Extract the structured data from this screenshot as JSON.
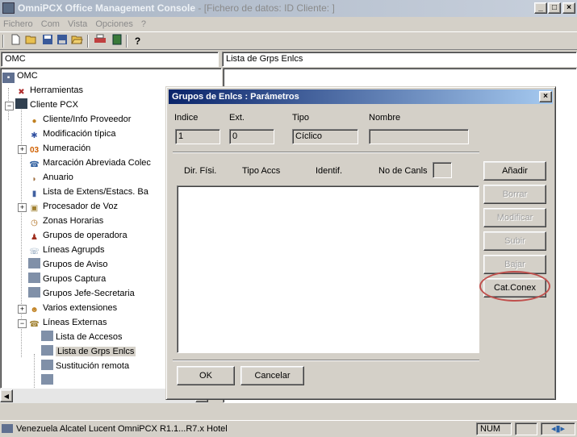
{
  "window": {
    "title_app": "OmniPCX Office Management Console",
    "title_detail": " - [Fichero de datos:    ID Cliente: ]",
    "btn_min": "_",
    "btn_max": "□",
    "btn_close": "×"
  },
  "menu": [
    "Fichero",
    "Com",
    "Vista",
    "Opciones",
    "?"
  ],
  "pathbar": {
    "left": "OMC",
    "right": "Lista de Grps Enlcs"
  },
  "tree": {
    "items": [
      {
        "label": "OMC"
      },
      {
        "label": "Herramientas"
      },
      {
        "label": "Cliente PCX"
      },
      {
        "label": "Cliente/Info Proveedor"
      },
      {
        "label": "Modificación típica"
      },
      {
        "label": "Numeración",
        "prefix": "03"
      },
      {
        "label": "Marcación Abreviada Colec"
      },
      {
        "label": "Anuario"
      },
      {
        "label": "Lista de Extens/Estacs. Ba"
      },
      {
        "label": "Procesador de Voz"
      },
      {
        "label": "Zonas Horarias"
      },
      {
        "label": "Grupos de operadora"
      },
      {
        "label": "Líneas Agrupds"
      },
      {
        "label": "Grupos de Aviso"
      },
      {
        "label": "Grupos Captura"
      },
      {
        "label": "Grupos Jefe-Secretaria"
      },
      {
        "label": "Varios extensiones"
      },
      {
        "label": "Líneas Externas"
      },
      {
        "label": "Lista de Accesos"
      },
      {
        "label": "Lista de Grps Enlcs"
      },
      {
        "label": "Sustitución remota"
      }
    ],
    "expanders": {
      "minus": "−",
      "plus": "+"
    }
  },
  "dialog": {
    "title": "Grupos de Enlcs : Parámetros",
    "close": "×",
    "labels": {
      "indice": "Indice",
      "ext": "Ext.",
      "tipo": "Tipo",
      "nombre": "Nombre"
    },
    "values": {
      "indice": "1",
      "ext": "0",
      "tipo": "Cíclico",
      "nombre": ""
    },
    "columns": [
      "Dir. Físi.",
      "Tipo Accs",
      "Identif.",
      "No de Canls"
    ],
    "buttons": {
      "anadir": "Añadir",
      "borrar": "Borrar",
      "modificar": "Modificar",
      "subir": "Subir",
      "bajar": "Bajar",
      "catconex": "Cat.Conex",
      "ok": "OK",
      "cancelar": "Cancelar"
    }
  },
  "statusbar": {
    "text": "Venezuela Alcatel Lucent OmniPCX R1.1...R7.x Hotel",
    "num": "NUM"
  },
  "colors": {
    "highlight_oval": "#c0504d",
    "dialog_title": "#0a246a"
  }
}
